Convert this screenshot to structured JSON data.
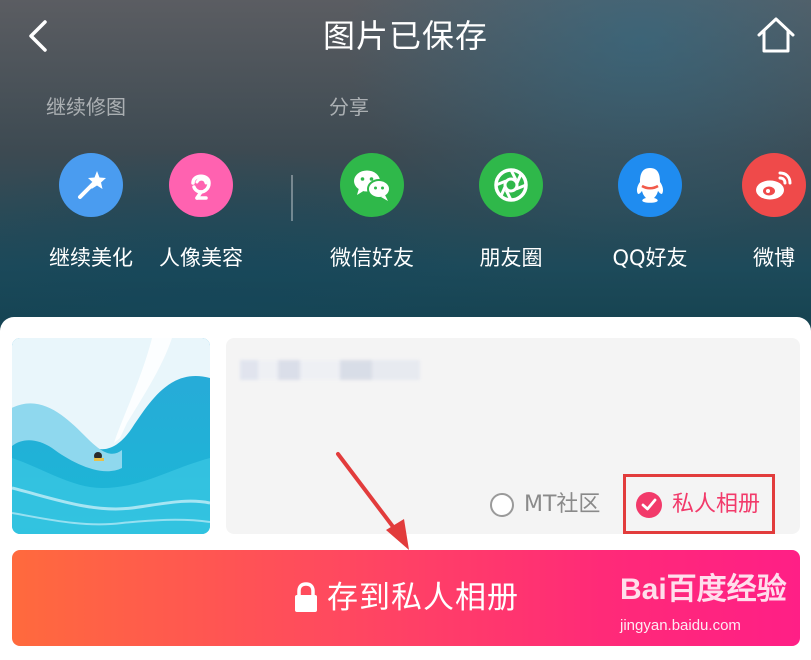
{
  "header": {
    "title": "图片已保存",
    "back_icon": "chevron-left-icon",
    "home_icon": "home-icon"
  },
  "sections": {
    "edit_label": "继续修图",
    "share_label": "分享"
  },
  "edit_actions": [
    {
      "label": "继续美化",
      "icon": "magic-wand-icon",
      "color": "#4a9cf0"
    },
    {
      "label": "人像美容",
      "icon": "portrait-icon",
      "color": "#ff62b0"
    }
  ],
  "share_actions": [
    {
      "label": "微信好友",
      "icon": "wechat-icon",
      "color": "#2fb84a"
    },
    {
      "label": "朋友圈",
      "icon": "moments-icon",
      "color": "#2fb84a"
    },
    {
      "label": "QQ好友",
      "icon": "qq-icon",
      "color": "#1f8cf0"
    },
    {
      "label": "微博",
      "icon": "weibo-icon",
      "color": "#ef4a4a"
    }
  ],
  "post": {
    "thumbnail_icon": "surf-photo-thumbnail",
    "options": [
      {
        "label": "MT社区",
        "selected": false
      },
      {
        "label": "私人相册",
        "selected": true
      }
    ]
  },
  "save_button": {
    "label": "存到私人相册",
    "icon": "lock-icon"
  },
  "watermark": {
    "brand": "Bai百度经验",
    "url": "jingyan.baidu.com"
  },
  "colors": {
    "accent": "#f23a6a",
    "highlight_box": "#e23c3c",
    "button_gradient_start": "#ff6a3d",
    "button_gradient_end": "#ff1f86"
  }
}
